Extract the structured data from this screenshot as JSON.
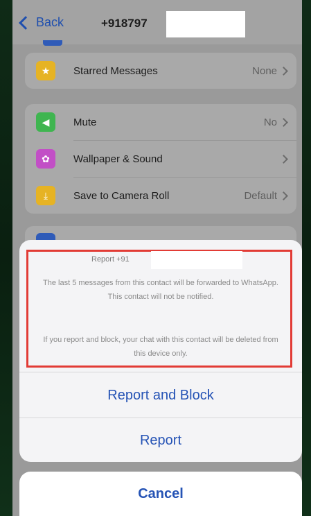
{
  "header": {
    "back_label": "Back",
    "contact_number": "+918797"
  },
  "settings_group_1": [
    {
      "label": "Starred Messages",
      "value": "None",
      "icon": "star-icon",
      "icon_color": "#e6b324"
    }
  ],
  "settings_group_2": [
    {
      "label": "Mute",
      "value": "No",
      "icon": "speaker-icon",
      "icon_color": "#3fb550"
    },
    {
      "label": "Wallpaper & Sound",
      "value": "",
      "icon": "flower-icon",
      "icon_color": "#c24fc6"
    },
    {
      "label": "Save to Camera Roll",
      "value": "Default",
      "icon": "download-icon",
      "icon_color": "#e6b324"
    }
  ],
  "sheet": {
    "title": "Report +91",
    "message_1": "The last 5 messages from this contact will be forwarded to WhatsApp. This contact will not be notified.",
    "message_2": "If you report and block, your chat with this contact will be deleted from this device only.",
    "report_block_label": "Report and Block",
    "report_label": "Report",
    "cancel_label": "Cancel"
  },
  "colors": {
    "accent": "#2553b5",
    "highlight_border": "#e23b35"
  }
}
